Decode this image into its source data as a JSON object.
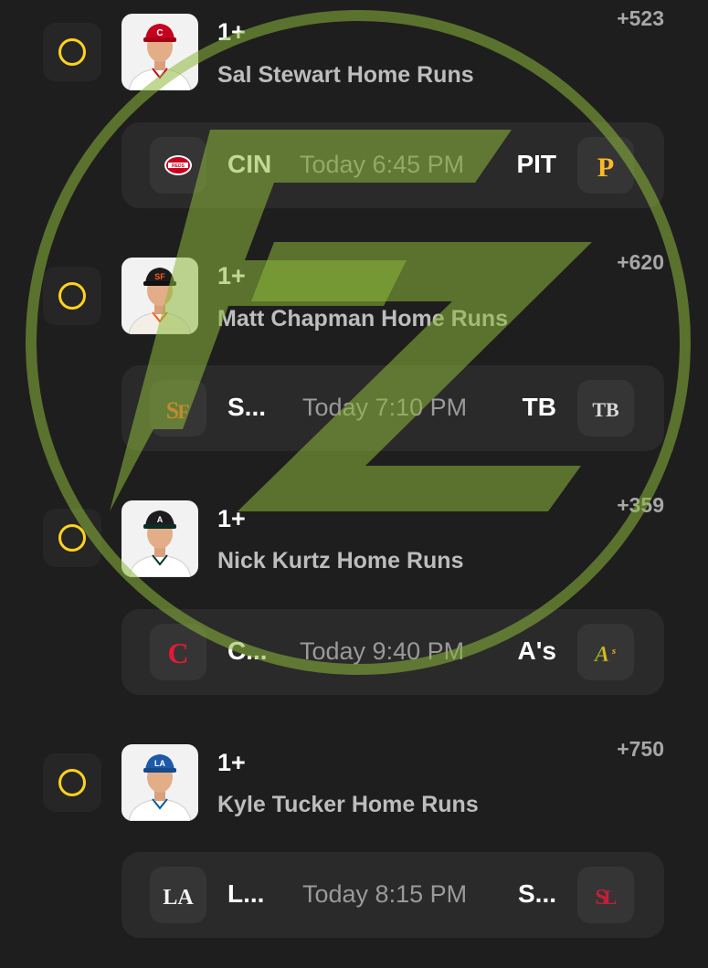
{
  "picks": [
    {
      "line": "1+",
      "market": "Sal Stewart Home Runs",
      "odds": "+523",
      "player_icon": "player-headshot-reds",
      "game": {
        "left_team": "CIN",
        "left_logo": "reds-logo-icon",
        "time": "Today 6:45 PM",
        "right_team": "PIT",
        "right_logo": "pirates-logo-icon"
      }
    },
    {
      "line": "1+",
      "market": "Matt Chapman Home Runs",
      "odds": "+620",
      "player_icon": "player-headshot-giants",
      "game": {
        "left_team": "S...",
        "left_logo": "giants-logo-icon",
        "time": "Today 7:10 PM",
        "right_team": "TB",
        "right_logo": "rays-logo-icon"
      }
    },
    {
      "line": "1+",
      "market": "Nick Kurtz Home Runs",
      "odds": "+359",
      "player_icon": "player-headshot-athletics",
      "game": {
        "left_team": "C...",
        "left_logo": "guardians-logo-icon",
        "time": "Today 9:40 PM",
        "right_team": "A's",
        "right_logo": "athletics-logo-icon"
      }
    },
    {
      "line": "1+",
      "market": "Kyle Tucker Home Runs",
      "odds": "+750",
      "player_icon": "player-headshot-dodgers",
      "game": {
        "left_team": "L...",
        "left_logo": "dodgers-logo-icon",
        "time": "Today 8:15 PM",
        "right_team": "S...",
        "right_logo": "cardinals-logo-icon"
      }
    }
  ],
  "colors": {
    "background": "#1e1e1e",
    "card": "#2a2a2a",
    "radio_ring": "#ffd21f",
    "watermark": "#8cb83a"
  },
  "watermark_icon": "fz-logo-watermark"
}
